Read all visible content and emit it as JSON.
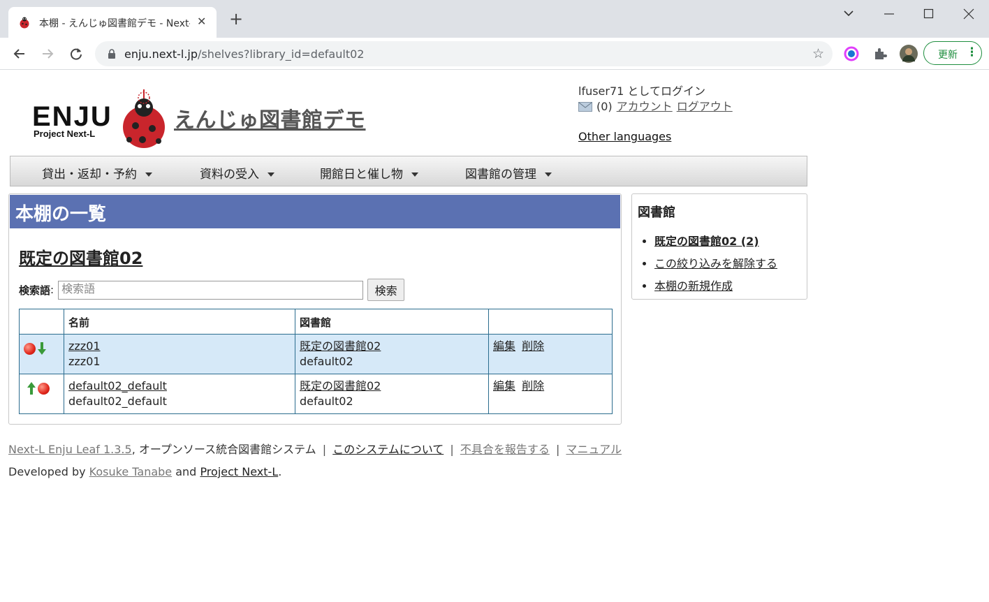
{
  "browser": {
    "tab_title": "本棚 - えんじゅ図書館デモ - Next-L Enju Leaf",
    "tab_close": "✕",
    "new_tab": "+",
    "url_host": "enju.next-l.jp",
    "url_path": "/shelves?library_id=default02",
    "update_label": "更新",
    "window_min": "—",
    "window_max": "☐",
    "window_close": "✕"
  },
  "header": {
    "logo_text": "ENJU Project Next-L",
    "site_title": "えんじゅ図書館デモ",
    "login_status": "lfuser71 としてログイン",
    "message_count": "(0)",
    "account_link": "アカウント",
    "logout_link": "ログアウト",
    "other_languages": "Other languages"
  },
  "menu": [
    {
      "label": "貸出・返却・予約"
    },
    {
      "label": "資料の受入"
    },
    {
      "label": "開館日と催し物"
    },
    {
      "label": "図書館の管理"
    }
  ],
  "main": {
    "heading": "本棚の一覧",
    "library_name": "既定の図書館02",
    "search_label": "検索語",
    "search_colon": ":",
    "search_placeholder": "検索語",
    "search_button": "検索",
    "columns": [
      "",
      "名前",
      "図書館",
      ""
    ],
    "rows": [
      {
        "name_link": "zzz01",
        "name_sub": "zzz01",
        "library_link": "既定の図書館02",
        "library_sub": "default02",
        "edit": "編集",
        "delete": "削除",
        "icons": [
          "red-ball",
          "down-arrow"
        ]
      },
      {
        "name_link": "default02_default",
        "name_sub": "default02_default",
        "library_link": "既定の図書館02",
        "library_sub": "default02",
        "edit": "編集",
        "delete": "削除",
        "icons": [
          "up-arrow",
          "red-ball"
        ]
      }
    ]
  },
  "sidebar": {
    "title": "図書館",
    "items": [
      {
        "label": "既定の図書館02 (2)"
      },
      {
        "label": "この絞り込みを解除する"
      },
      {
        "label": "本棚の新規作成"
      }
    ]
  },
  "footer": {
    "product_link": "Next-L Enju Leaf 1.3.5",
    "product_desc": ", オープンソース統合図書館システム",
    "about_link": "このシステムについて",
    "bug_link": "不具合を報告する",
    "manual_link": "マニュアル",
    "separator": "|",
    "developed_by": "Developed by",
    "author_link": "Kosuke Tanabe",
    "and_text": "and",
    "project_link": "Project Next-L",
    "period": "."
  },
  "colors": {
    "heading_bar": "#5b71b2",
    "highlight_row": "#d6e9f8",
    "table_border": "#2b6c8e",
    "update_green": "#1e8e3e"
  }
}
